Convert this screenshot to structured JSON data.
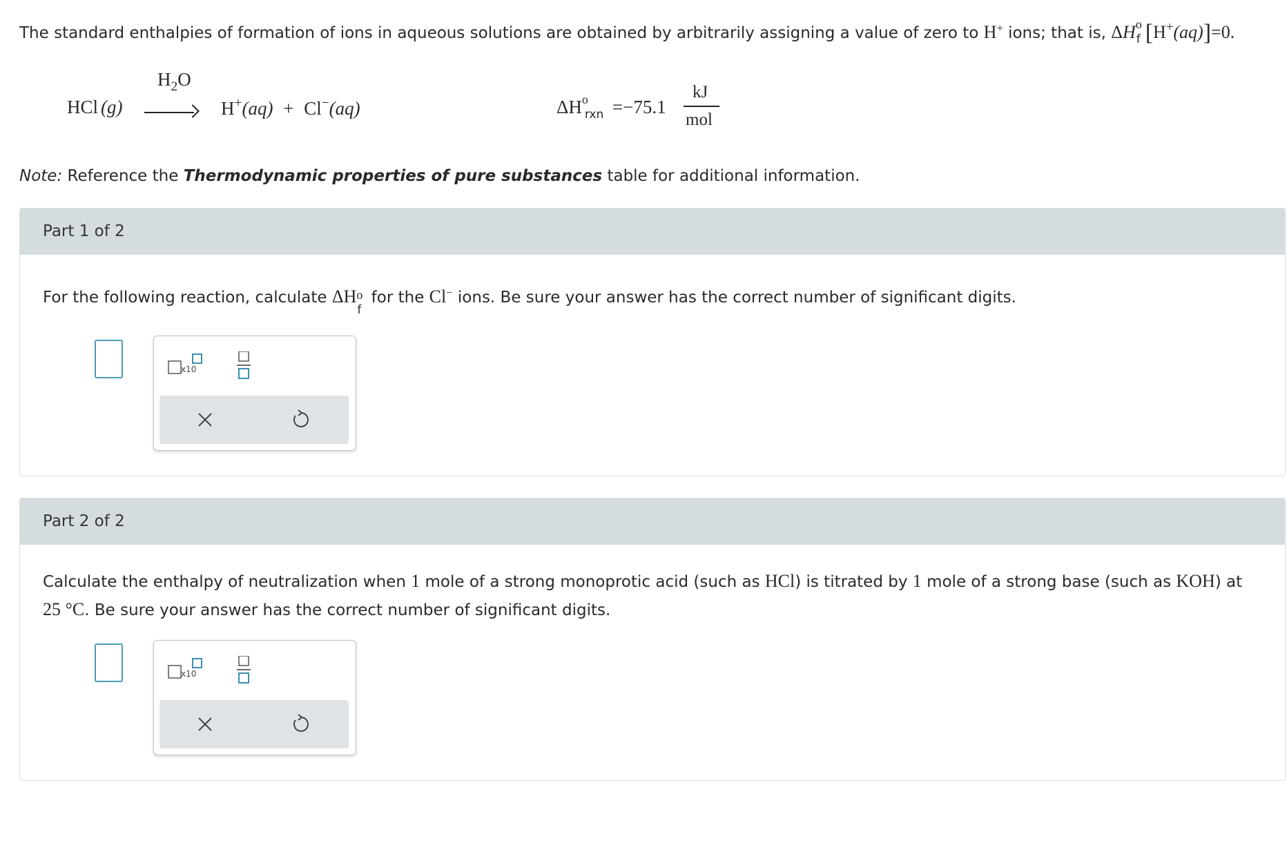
{
  "intro": {
    "text_before_h": "The standard enthalpies of formation of ions in aqueous solutions are obtained by arbitrarily assigning a value of zero to ",
    "h_symbol": "H",
    "plus": "+",
    "text_after_h": " ions; that is, ",
    "delta": "Δ",
    "H": "H",
    "degree": "o",
    "f": "f",
    "bracket_open": "[",
    "h2": "H",
    "aq": "(aq)",
    "bracket_close": "]",
    "equals_zero": "=0."
  },
  "reaction": {
    "reactant": "HCl",
    "reactant_state": "(g)",
    "solvent": "H",
    "solvent_sub": "2",
    "solvent_end": "O",
    "product1": "H",
    "product1_charge": "+",
    "product1_state": "(aq)",
    "plus_sign": "+",
    "product2": "Cl",
    "product2_charge": "−",
    "product2_state": "(aq)",
    "delta_label": "ΔH",
    "degree": "o",
    "rxn_sub": "rxn",
    "equals_value": "=−75.1",
    "unit_num": "kJ",
    "unit_den": "mol"
  },
  "note": {
    "label": "Note:",
    "text_before": " Reference the ",
    "bold": "Thermodynamic properties of pure substances",
    "text_after": " table for additional information."
  },
  "part1": {
    "header": "Part 1 of 2",
    "q_before": "For the following reaction, calculate ",
    "q_delta": "ΔH",
    "q_deg": "o",
    "q_f": "f",
    "q_mid": " for the ",
    "q_cl": "Cl",
    "q_charge": "−",
    "q_after": " ions. Be sure your answer has the correct number of significant digits.",
    "x10": "x10"
  },
  "part2": {
    "header": "Part 2 of 2",
    "q_a": "Calculate the enthalpy of neutralization when ",
    "q_one1": "1",
    "q_b": " mole of a strong monoprotic acid (such as ",
    "q_hcl": "HCl",
    "q_c": ") is titrated by ",
    "q_one2": "1",
    "q_d": " mole of a strong base (such as ",
    "q_koh": "KOH",
    "q_e": ") at",
    "q_temp": "25 °C",
    "q_f": ". Be sure your answer has the correct number of significant digits.",
    "x10": "x10"
  },
  "icons": [
    "scientific-notation-icon",
    "fraction-icon",
    "clear-icon",
    "undo-icon"
  ],
  "colors": {
    "accent": "#4a9bb4",
    "panel_header": "#d5dce0",
    "action_bar": "#dfe3e6"
  }
}
